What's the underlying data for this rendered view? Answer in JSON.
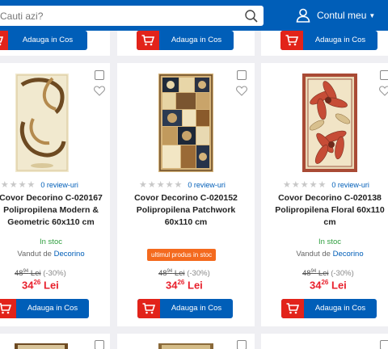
{
  "header": {
    "search_placeholder": "Cauti azi?",
    "account_label": "Contul meu"
  },
  "common": {
    "cart_label": "Adauga in Cos",
    "reviews_label": "0 review-uri",
    "sold_by_prefix": "Vandut de",
    "seller": "Decorino",
    "old_price_int": "48",
    "old_price_dec": "94",
    "old_price_cur": "Lei",
    "discount": "(-30%)",
    "price_int": "34",
    "price_dec": "26",
    "price_cur": "Lei",
    "rating_stars": 0
  },
  "products": [
    {
      "title_line1": "Covor Decorino C-020167",
      "title_line2": "Polipropilena Modern &",
      "title_line3": "Geometric 60x110 cm",
      "status": "In stoc"
    },
    {
      "title_line1": "Covor Decorino C-020152",
      "title_line2": "Polipropilena Patchwork",
      "title_line3": "60x110 cm",
      "status": "ultimul produs in stoc"
    },
    {
      "title_line1": "Covor Decorino C-020138",
      "title_line2": "Polipropilena Floral 60x110",
      "title_line3": "cm",
      "status": "In stoc"
    }
  ],
  "icons": {
    "search": "search-icon",
    "user": "user-icon",
    "cart": "cart-icon",
    "heart": "heart-icon"
  },
  "colors": {
    "brand_blue": "#005eb8",
    "cart_red": "#e2231a",
    "price_red": "#e8212d",
    "stock_green": "#2e9e3e",
    "badge_orange": "#f46a1e"
  }
}
